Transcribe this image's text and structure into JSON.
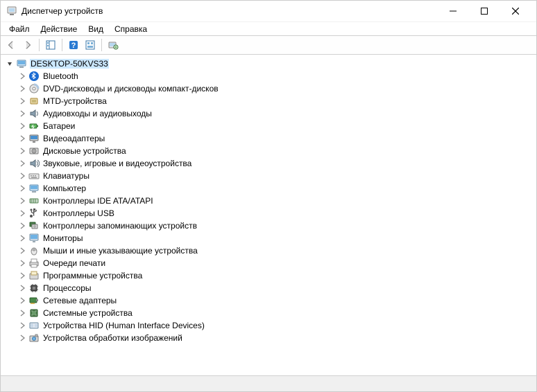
{
  "window": {
    "title": "Диспетчер устройств",
    "controls": {
      "min": "min",
      "max": "max",
      "close": "close"
    }
  },
  "menu": {
    "file": "Файл",
    "action": "Действие",
    "view": "Вид",
    "help": "Справка"
  },
  "toolbar_icons": {
    "back": "back-arrow-icon",
    "forward": "forward-arrow-icon",
    "show_hidden": "show-hide-console-tree-icon",
    "help": "help-icon",
    "refresh": "scan-hardware-icon",
    "properties": "properties-icon"
  },
  "tree": {
    "root": {
      "label": "DESKTOP-50KVS33",
      "icon": "computer-icon",
      "expanded": true,
      "selected": true
    },
    "children": [
      {
        "label": "Bluetooth",
        "icon": "bluetooth-icon"
      },
      {
        "label": "DVD-дисководы и дисководы компакт-дисков",
        "icon": "disc-drive-icon"
      },
      {
        "label": "MTD-устройства",
        "icon": "mtd-device-icon"
      },
      {
        "label": "Аудиовходы и аудиовыходы",
        "icon": "audio-io-icon"
      },
      {
        "label": "Батареи",
        "icon": "battery-icon"
      },
      {
        "label": "Видеоадаптеры",
        "icon": "display-adapter-icon"
      },
      {
        "label": "Дисковые устройства",
        "icon": "disk-drive-icon"
      },
      {
        "label": "Звуковые, игровые и видеоустройства",
        "icon": "sound-device-icon"
      },
      {
        "label": "Клавиатуры",
        "icon": "keyboard-icon"
      },
      {
        "label": "Компьютер",
        "icon": "computer-icon"
      },
      {
        "label": "Контроллеры IDE ATA/ATAPI",
        "icon": "ide-controller-icon"
      },
      {
        "label": "Контроллеры USB",
        "icon": "usb-controller-icon"
      },
      {
        "label": "Контроллеры запоминающих устройств",
        "icon": "storage-controller-icon"
      },
      {
        "label": "Мониторы",
        "icon": "monitor-icon"
      },
      {
        "label": "Мыши и иные указывающие устройства",
        "icon": "mouse-icon"
      },
      {
        "label": "Очереди печати",
        "icon": "print-queue-icon"
      },
      {
        "label": "Программные устройства",
        "icon": "software-device-icon"
      },
      {
        "label": "Процессоры",
        "icon": "processor-icon"
      },
      {
        "label": "Сетевые адаптеры",
        "icon": "network-adapter-icon"
      },
      {
        "label": "Системные устройства",
        "icon": "system-device-icon"
      },
      {
        "label": "Устройства HID (Human Interface Devices)",
        "icon": "hid-device-icon"
      },
      {
        "label": "Устройства обработки изображений",
        "icon": "imaging-device-icon"
      }
    ]
  }
}
